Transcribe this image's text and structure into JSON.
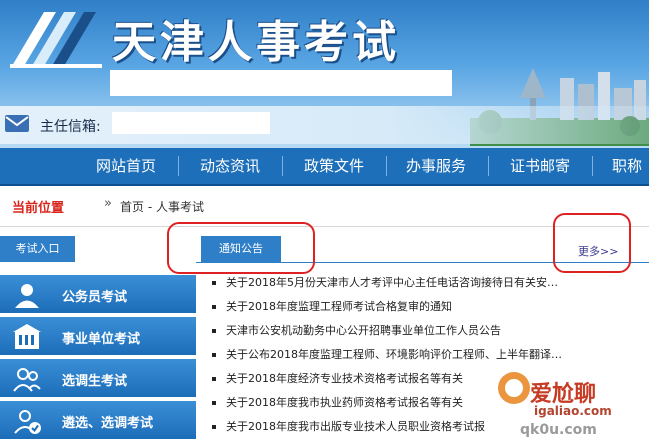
{
  "header": {
    "site_title": "天津人事考试",
    "mail_label": "主任信箱:"
  },
  "nav": {
    "items": [
      "网站首页",
      "动态资讯",
      "政策文件",
      "办事服务",
      "证书邮寄",
      "职称"
    ]
  },
  "breadcrumb": {
    "current_label": "当前位置",
    "arrows": "»",
    "path": "首页 - 人事考试"
  },
  "sidebar": {
    "tab_label": "考试入口",
    "items": [
      {
        "label": "公务员考试",
        "icon": "person-icon"
      },
      {
        "label": "事业单位考试",
        "icon": "building-icon"
      },
      {
        "label": "选调生考试",
        "icon": "people-icon"
      },
      {
        "label": "遴选、选调考试",
        "icon": "person-check-icon"
      }
    ]
  },
  "notice": {
    "tab_label": "通知公告",
    "more_label": "更多>>",
    "items": [
      "关于2018年5月份天津市人才考评中心主任电话咨询接待日有关安…",
      "关于2018年度监理工程师考试合格复审的通知",
      "天津市公安机动勤务中心公开招聘事业单位工作人员公告",
      "关于公布2018年度监理工程师、环境影响评价工程师、上半年翻译…",
      "关于2018年度经济专业技术资格考试报名等有关",
      "关于2018年度我市执业药师资格考试报名等有关",
      "关于2018年度我市出版专业技术人员职业资格考试报"
    ]
  },
  "watermark": {
    "text": "爱尬聊",
    "url": "igaliao.com",
    "url2": "qk0u.com"
  },
  "colors": {
    "nav_blue": "#1e6fba",
    "accent_red": "#d9261c",
    "annotation_red": "#e02121"
  }
}
